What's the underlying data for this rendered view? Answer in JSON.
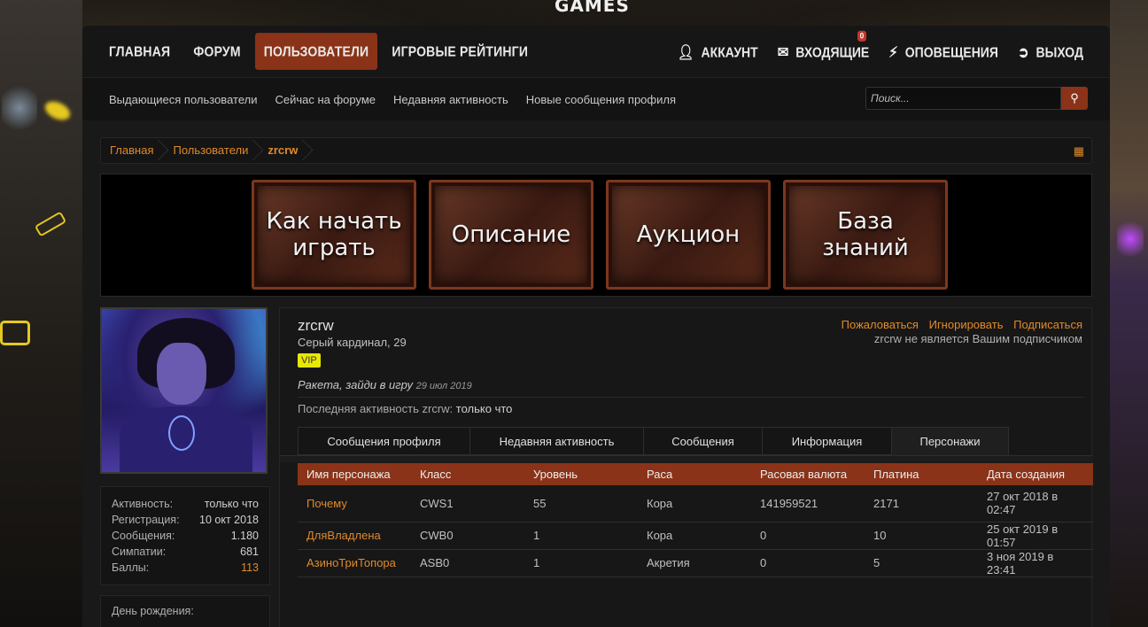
{
  "logo": "GAMES",
  "topnav": {
    "items": [
      "ГЛАВНАЯ",
      "ФОРУМ",
      "ПОЛЬЗОВАТЕЛИ",
      "ИГРОВЫЕ РЕЙТИНГИ"
    ],
    "active_index": 2,
    "account": "АККАУНТ",
    "inbox": "ВХОДЯЩИЕ",
    "inbox_badge": "0",
    "alerts": "ОПОВЕЩЕНИЯ",
    "logout": "ВЫХОД"
  },
  "subnav": {
    "items": [
      "Выдающиеся пользователи",
      "Сейчас на форуме",
      "Недавняя активность",
      "Новые сообщения профиля"
    ],
    "search_placeholder": "Поиск..."
  },
  "breadcrumb": [
    "Главная",
    "Пользователи",
    "zrcrw"
  ],
  "banner": [
    "Как начать\nиграть",
    "Описание",
    "Аукцион",
    "База\nзнаний"
  ],
  "profile": {
    "username": "zrcrw",
    "title": "Серый кардинал, 29",
    "badge": "VIP",
    "status_text": "Ракета, зайди в игру",
    "status_date": "29 июл 2019",
    "last_activity_label": "Последняя активность zrcrw:",
    "last_activity_value": "только что",
    "actions": [
      "Пожаловаться",
      "Игнорировать",
      "Подписаться"
    ],
    "follow_note": "zrcrw не является Вашим подписчиком"
  },
  "stats": [
    {
      "label": "Активность:",
      "value": "только что"
    },
    {
      "label": "Регистрация:",
      "value": "10 окт 2018"
    },
    {
      "label": "Сообщения:",
      "value": "1.180"
    },
    {
      "label": "Симпатии:",
      "value": "681"
    },
    {
      "label": "Баллы:",
      "value": "113"
    }
  ],
  "birthday_label": "День рождения:",
  "tabs": [
    "Сообщения профиля",
    "Недавняя активность",
    "Сообщения",
    "Информация",
    "Персонажи"
  ],
  "active_tab": 4,
  "table": {
    "headers": [
      "Имя персонажа",
      "Класс",
      "Уровень",
      "Раса",
      "Расовая валюта",
      "Платина",
      "Дата создания"
    ],
    "rows": [
      [
        "Почему",
        "CWS1",
        "55",
        "Кора",
        "141959521",
        "2171",
        "27 окт 2018 в 02:47"
      ],
      [
        "ДляВладлена",
        "CWB0",
        "1",
        "Кора",
        "0",
        "10",
        "25 окт 2019 в 01:57"
      ],
      [
        "АзиноТриТопора",
        "ASB0",
        "1",
        "Акретия",
        "0",
        "5",
        "3 ноя 2019 в 23:41"
      ]
    ]
  }
}
